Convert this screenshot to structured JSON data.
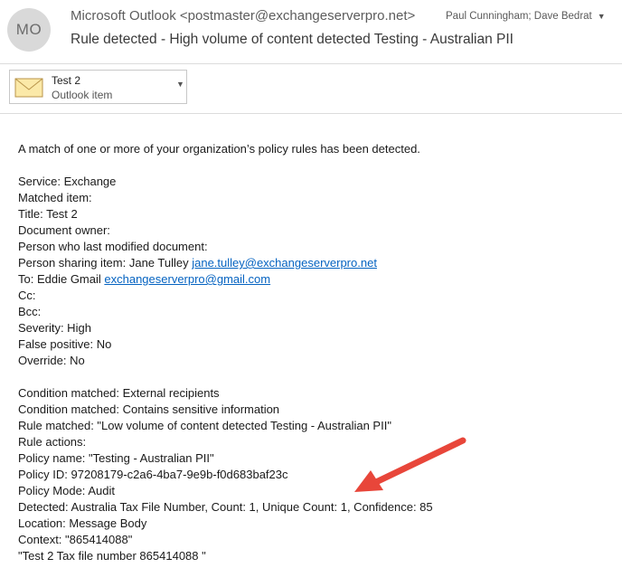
{
  "sender": {
    "avatar_initials": "MO",
    "from": "Microsoft Outlook <postmaster@exchangeserverpro.net>",
    "recipients": "Paul Cunningham; Dave Bedrat"
  },
  "message": {
    "subject": "Rule detected - High volume of content detected Testing - Australian PII"
  },
  "attachment": {
    "name": "Test 2",
    "type": "Outlook item",
    "icon": "envelope-icon"
  },
  "body": {
    "intro": "A match of one or more of your organization’s policy rules has been detected.",
    "service": "Service: Exchange",
    "matched_item": "Matched item:",
    "title": "Title: Test 2",
    "document_owner": "Document owner:",
    "last_modified": "Person who last modified document:",
    "sharing_prefix": "Person sharing item: Jane Tulley ",
    "sharing_email": "jane.tulley@exchangeserverpro.net",
    "to_prefix": "To: Eddie Gmail ",
    "to_email": "exchangeserverpro@gmail.com",
    "cc": "Cc:",
    "bcc": "Bcc:",
    "severity": "Severity: High",
    "false_positive": "False positive: No",
    "override": "Override: No",
    "condition1": "Condition matched: External recipients",
    "condition2": "Condition matched: Contains sensitive information",
    "rule_matched": "Rule matched: \"Low volume of content detected Testing - Australian PII\"",
    "rule_actions": "Rule actions:",
    "policy_name": "Policy name: \"Testing - Australian PII\"",
    "policy_id": "Policy ID: 97208179-c2a6-4ba7-9e9b-f0d683baf23c",
    "policy_mode": "Policy Mode: Audit",
    "detected": "Detected: Australia Tax File Number, Count: 1, Unique Count: 1, Confidence: 85",
    "location": "Location: Message Body",
    "context": "Context: \"865414088\"",
    "context2": "\"Test 2 Tax file number 865414088 \""
  },
  "colors": {
    "link": "#0563c1",
    "annotation_arrow": "#e8463a",
    "avatar_bg": "#d9d9d9"
  }
}
